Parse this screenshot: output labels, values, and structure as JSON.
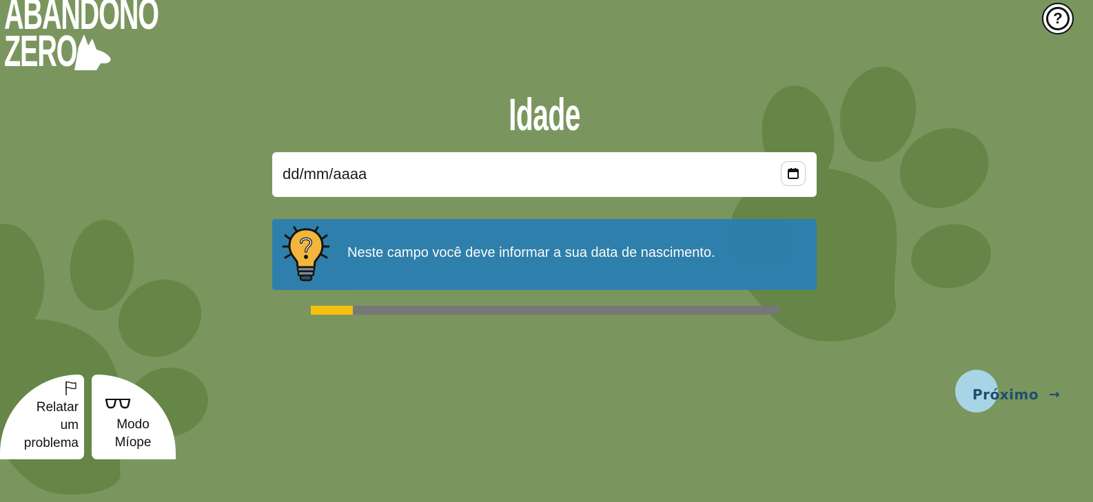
{
  "logo": {
    "line1": "ABANDONO",
    "line2": "ZERO",
    "icon": "dog-head-icon"
  },
  "help": {
    "label": "?",
    "icon": "question-circle-icon"
  },
  "form": {
    "title": "Idade",
    "date_placeholder": "dd/mm/aaaa",
    "calendar_icon": "calendar-icon"
  },
  "info": {
    "icon": "lightbulb-question-icon",
    "text": "Neste campo você deve informar a sua data de nascimento."
  },
  "progress": {
    "fraction": 0.09
  },
  "navigation": {
    "next_label": "Próximo",
    "next_arrow": "→"
  },
  "accessibility": {
    "report_lines": [
      "Relatar",
      "um",
      "problema"
    ],
    "report_icon": "flag-icon",
    "myopia_lines": [
      "Modo",
      "Míope"
    ],
    "myopia_icon": "glasses-icon"
  },
  "colors": {
    "background": "#7a965e",
    "paw": "#638546",
    "info_box": "#2c7fae",
    "progress_fill": "#f4c10f",
    "progress_track": "#777777",
    "next_circle": "#a8d5e5",
    "next_text": "#1f4e6e"
  }
}
